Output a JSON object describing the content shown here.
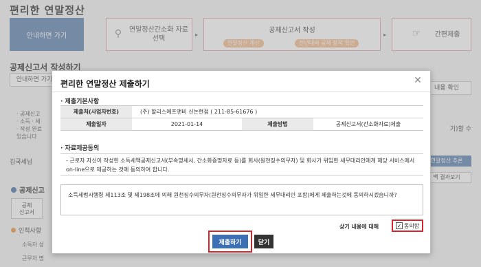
{
  "background": {
    "page_title": "편리한 연말정산",
    "steps": {
      "guide": "안내하면 가기",
      "select": "연말정산간소화 자료선택",
      "write_title": "공제신고서 작성",
      "write_sub1": "연말정산 계산",
      "write_sub2": "전년대비 공제 항목 확인",
      "simple_submit": "간편제출"
    },
    "section_title": "공제신고서 작성하기",
    "guide_button": "안내하면 가기",
    "content_check": "내용 확인",
    "left_list": [
      "· 공제신고",
      "· 소득 · 세",
      "· 작성 완료",
      "있습니다"
    ],
    "right_text": "기)할 수",
    "left_label": "김국세님",
    "right_blue": "연말정산 추론",
    "right_btn2": "백 결과보기",
    "deduct_title": "공제신고",
    "tab": "공제\n신고서",
    "personal": "인적사항",
    "row1": "소득자 성",
    "row2": "근무처 명"
  },
  "modal": {
    "title": "편리한 연말정산 제출하기",
    "section1": "· 제출기본사항",
    "table": {
      "r1_h": "제출처(사업자번호)",
      "r1_v": "(주) 할리스에프앤비 신논현점 ( 211-85-61676 )",
      "r2_h1": "제출일자",
      "r2_v1": "2021-01-14",
      "r2_h2": "제출방법",
      "r2_v2": "공제신고서(간소화자료)제출"
    },
    "section2": "· 자료제공동의",
    "consent_text": "- 근로자 자신이 작성한 소득세액공제신고서(부속명세서, 간소화증명자료 등)를 회사(원천징수의무자) 및 회사가 위임한 세무대리인에게 해당 서비스에서 on-line으로 제공하는 것에 동의하여 합니다.",
    "law_text": "소득세법시행령 제113조 및 제198조에 의해 원천징수의무자(원천징수의무자가 위임한 세무대리인 포함)에게 제출하는것에 동의하시겠습니까?",
    "agree_label": "상기 내용에 대해",
    "agree_text": "동의함",
    "checkbox_mark": "✓",
    "submit_label": "제출하기",
    "close_label": "닫기",
    "close_x": "✕"
  }
}
